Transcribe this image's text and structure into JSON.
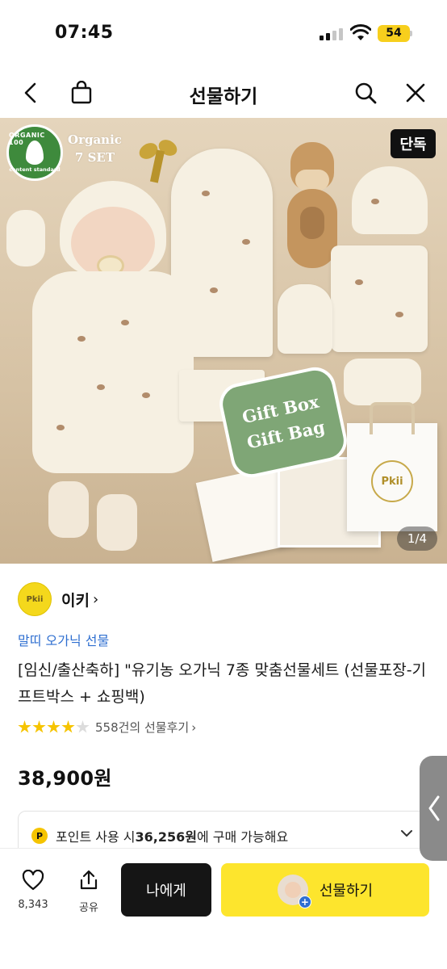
{
  "status_bar": {
    "time": "07:45",
    "battery": "54"
  },
  "nav": {
    "title": "선물하기"
  },
  "hero": {
    "badge_top": "ORGANIC 100",
    "badge_bottom": "content standard",
    "organic_line1": "Organic",
    "organic_line2": "7 SET",
    "exclusive_badge": "단독",
    "gift_line1": "Gift Box",
    "gift_line2": "Gift Bag",
    "page_counter": "1/4",
    "brand_mark": "Pkii"
  },
  "seller": {
    "name": "이키",
    "chevron": "›",
    "logo_text": "Pkii"
  },
  "category": "말띠 오가닉 선물",
  "product": {
    "title": "[임신/출산축하] \"유기농 오가닉 7종 맞춤선물세트 (선물포장-기프트박스 + 쇼핑백)",
    "rating": 4,
    "review_text": "558건의 선물후기",
    "review_chevron": "›",
    "price": "38,900원"
  },
  "points": {
    "icon": "P",
    "prefix": "포인트 사용 시 ",
    "amount": "36,256원",
    "suffix": "에 구매 가능해요"
  },
  "bottom": {
    "like_count": "8,343",
    "share_label": "공유",
    "self_button": "나에게",
    "gift_button": "선물하기"
  },
  "colors": {
    "accent_yellow": "#fde52d",
    "link_blue": "#2f6fd0",
    "star": "#f6c400",
    "dark_button": "#151515"
  }
}
